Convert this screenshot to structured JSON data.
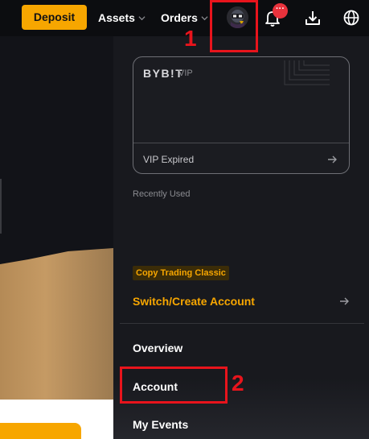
{
  "header": {
    "deposit_label": "Deposit",
    "assets_label": "Assets",
    "orders_label": "Orders",
    "notification_badge": "···"
  },
  "vip_card": {
    "brand": "BYB!T",
    "tag": "VIP",
    "status": "VIP Expired"
  },
  "recently_used_label": "Recently Used",
  "copy_trading_badge": "Copy Trading Classic",
  "switch_account_label": "Switch/Create Account",
  "menu": {
    "overview": "Overview",
    "account": "Account",
    "my_events": "My Events"
  },
  "annotations": {
    "first": "1",
    "second": "2"
  },
  "colors": {
    "accent": "#f7a600",
    "annotation": "#e8141c",
    "panel_bg": "#18191e",
    "page_bg": "#0c0d10"
  },
  "icons": [
    "chevron-down-icon",
    "bell-icon",
    "download-icon",
    "globe-icon",
    "arrow-right-icon"
  ]
}
